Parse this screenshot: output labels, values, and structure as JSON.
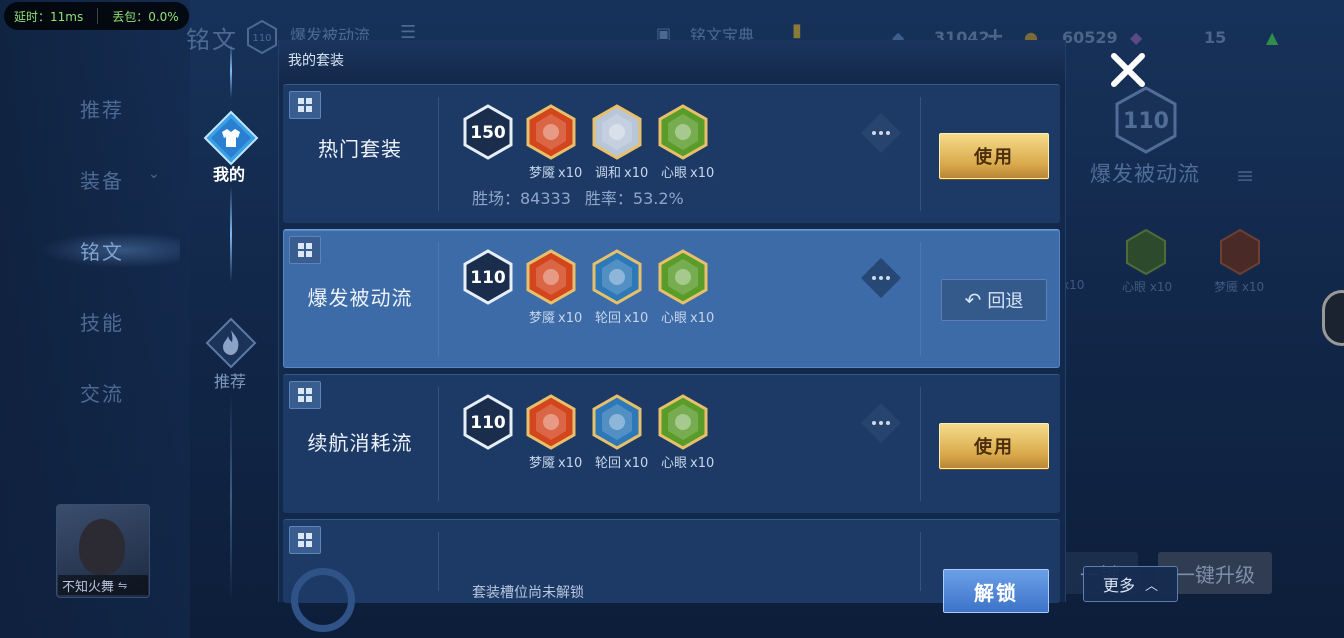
{
  "status_bar": {
    "latency": "延时：11ms",
    "packet_loss": "丢包：0.0%"
  },
  "header": {
    "title": "铭文",
    "level_badge": "110",
    "current_set_dim": "爆发被动流",
    "rune_dictionary_dim": "铭文宝典",
    "resources": {
      "diamonds": "31042",
      "coins": "60529",
      "misc": "15"
    }
  },
  "left_nav": {
    "items": [
      {
        "label": "推荐"
      },
      {
        "label": "装备"
      },
      {
        "label": "铭文"
      },
      {
        "label": "技能"
      },
      {
        "label": "交流"
      }
    ],
    "active_index": 2
  },
  "mode_tabs": {
    "mine": "我的",
    "recommended": "推荐"
  },
  "player": {
    "name": "不知火舞"
  },
  "panel": {
    "title": "我的套装",
    "sets": [
      {
        "name": "热门套装",
        "level": "150",
        "runes": [
          {
            "name": "梦魇",
            "count": "x10",
            "color": "#d2451d"
          },
          {
            "name": "调和",
            "count": "x10",
            "color": "#b8c6d8"
          },
          {
            "name": "心眼",
            "count": "x10",
            "color": "#5a9c2a"
          }
        ],
        "stats": {
          "wins": "胜场：84333",
          "win_rate": "胜率：53.2%"
        },
        "action": "使用",
        "selected": false
      },
      {
        "name": "爆发被动流",
        "level": "110",
        "runes": [
          {
            "name": "梦魇",
            "count": "x10",
            "color": "#d2451d"
          },
          {
            "name": "轮回",
            "count": "x10",
            "color": "#2d78b8"
          },
          {
            "name": "心眼",
            "count": "x10",
            "color": "#5a9c2a"
          }
        ],
        "action": "回退",
        "selected": true
      },
      {
        "name": "续航消耗流",
        "level": "110",
        "runes": [
          {
            "name": "梦魇",
            "count": "x10",
            "color": "#d2451d"
          },
          {
            "name": "轮回",
            "count": "x10",
            "color": "#2d78b8"
          },
          {
            "name": "心眼",
            "count": "x10",
            "color": "#5a9c2a"
          }
        ],
        "action": "使用",
        "selected": false
      },
      {
        "locked_text": "套装槽位尚未解锁",
        "action": "解锁"
      }
    ]
  },
  "right_panel": {
    "level": "110",
    "set_name": "爆发被动流",
    "rune_labels": [
      "x10",
      "心眼 x10",
      "梦魇 x10"
    ],
    "one_key_upgrade": "一键升级",
    "one_key_build": "一键",
    "more": "更多"
  },
  "colors": {
    "gold_button": "#d9a84a",
    "selected_card": "#3c6ba8",
    "card": "#1d3a66",
    "panel": "#13294b"
  }
}
